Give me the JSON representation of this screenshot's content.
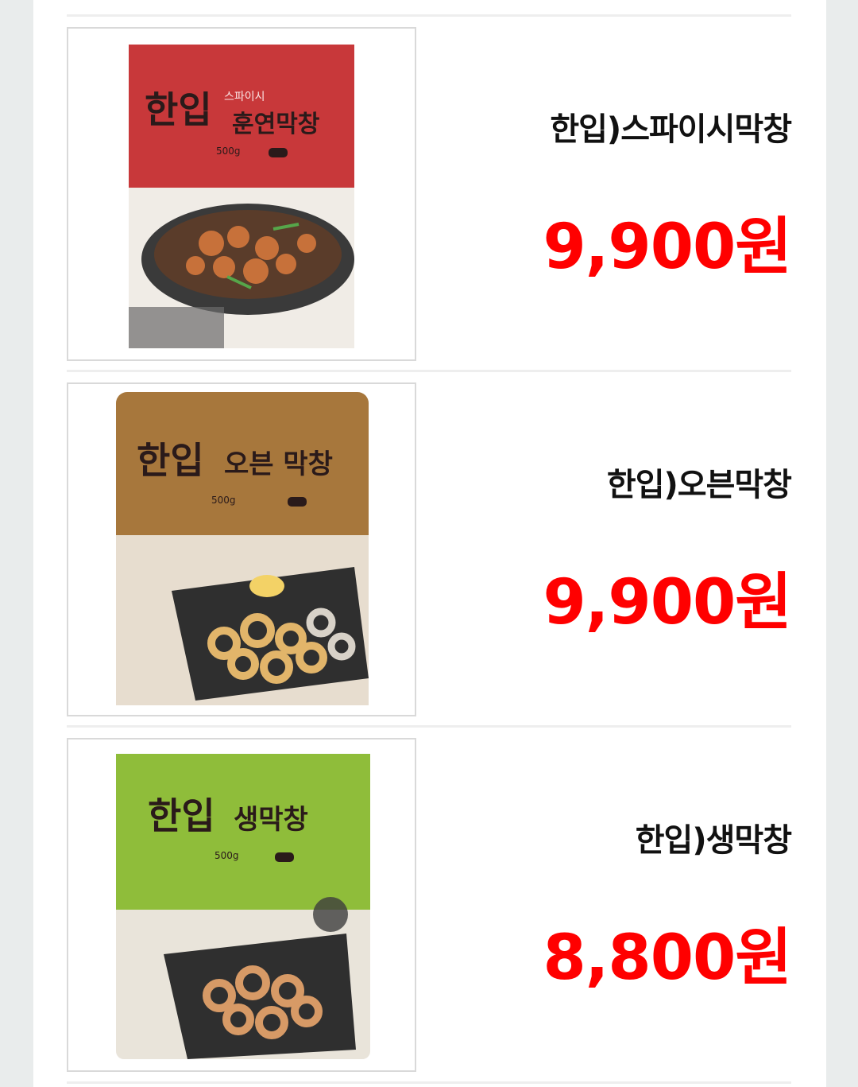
{
  "products": [
    {
      "name": "한입)스파이시막창",
      "price": "9,900원",
      "package": {
        "brand": "한입",
        "tag": "스파이시",
        "title": "훈연막창",
        "weight": "500g",
        "color": "#c8383a"
      }
    },
    {
      "name": "한입)오븐막창",
      "price": "9,900원",
      "package": {
        "brand": "한입",
        "title": "오븐 막창",
        "weight": "500g",
        "color": "#a7773c"
      }
    },
    {
      "name": "한입)생막창",
      "price": "8,800원",
      "package": {
        "brand": "한입",
        "title": "생막창",
        "weight": "500g",
        "color": "#8fbd3a"
      }
    }
  ],
  "colors": {
    "price": "#ff0000",
    "name": "#111111",
    "background": "#e9ecec"
  }
}
